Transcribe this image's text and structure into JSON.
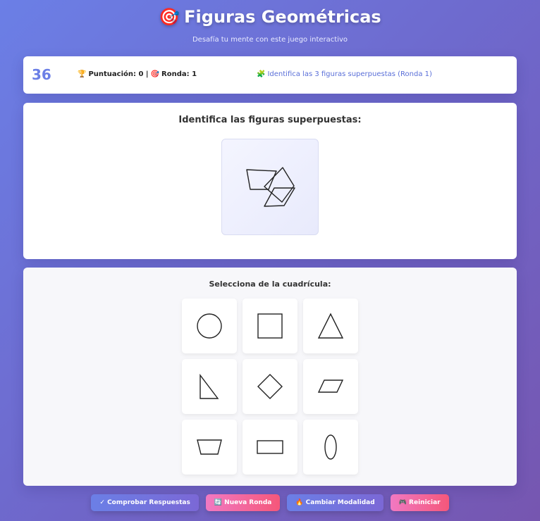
{
  "header": {
    "title_icon": "🎯",
    "title": "Figuras Geométricas",
    "subtitle": "Desafía tu mente con este juego interactivo"
  },
  "status": {
    "timer": "36",
    "score_icon": "🏆",
    "score_text": "Puntuación: 0 |",
    "round_icon": "🎯",
    "round_text": "Ronda: 1",
    "hint_icon": "🧩",
    "hint_text": "Identifica las 3 figuras superpuestas (Ronda 1)"
  },
  "puzzle": {
    "heading": "Identifica las figuras superpuestas:"
  },
  "selection": {
    "heading": "Selecciona de la cuadrícula:",
    "shapes": [
      "circle",
      "square",
      "triangle",
      "right-triangle",
      "diamond",
      "parallelogram",
      "trapezoid",
      "rectangle",
      "ellipse"
    ]
  },
  "buttons": {
    "check": "✓ Comprobar Respuestas",
    "new_round": "🔄 Nueva Ronda",
    "change_mode": "🔥 Cambiar Modalidad",
    "restart": "🎮 Reiniciar"
  },
  "colors": {
    "accent": "#6b7fe6",
    "pink": "#f5577a"
  }
}
